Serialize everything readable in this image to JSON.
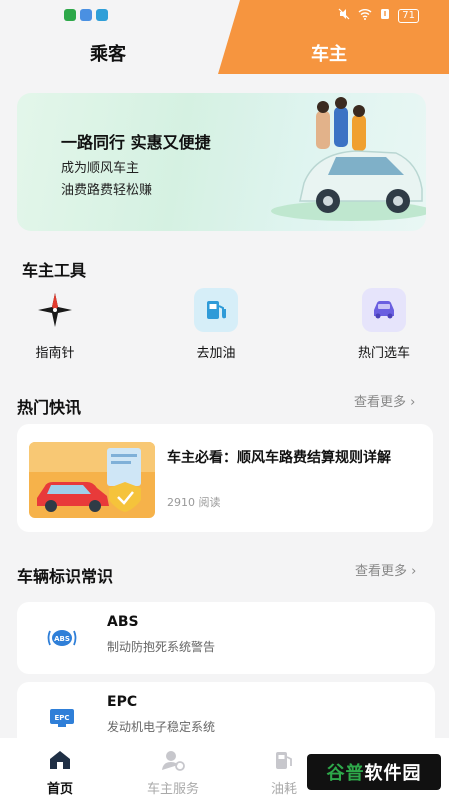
{
  "status_bar": {
    "battery": "71"
  },
  "tabs": [
    {
      "label": "乘客",
      "active": false
    },
    {
      "label": "车主",
      "active": true
    }
  ],
  "banner": {
    "title": "一路同行 实惠又便捷",
    "subtitle_line1": "成为顺风车主",
    "subtitle_line2": "油费路费轻松赚"
  },
  "tools_section": {
    "title": "车主工具",
    "items": [
      {
        "label": "指南针",
        "icon": "compass-icon"
      },
      {
        "label": "去加油",
        "icon": "fuel-pump-icon"
      },
      {
        "label": "热门选车",
        "icon": "car-icon"
      }
    ]
  },
  "news_section": {
    "title": "热门快讯",
    "more": "查看更多",
    "item": {
      "title": "车主必看：顺风车路费结算规则详解",
      "reads": "2910 阅读"
    }
  },
  "indicators_section": {
    "title": "车辆标识常识",
    "more": "查看更多",
    "items": [
      {
        "title": "ABS",
        "desc": "制动防抱死系统警告",
        "icon": "abs-warning-icon"
      },
      {
        "title": "EPC",
        "desc": "发动机电子稳定系统",
        "icon": "epc-warning-icon"
      }
    ]
  },
  "bottom_nav": [
    {
      "label": "首页",
      "icon": "home-icon",
      "active": true
    },
    {
      "label": "车主服务",
      "icon": "driver-service-icon",
      "active": false
    },
    {
      "label": "油耗",
      "icon": "fuel-icon",
      "active": false
    }
  ],
  "watermark": {
    "part1": "谷普",
    "part2": "软件园"
  },
  "colors": {
    "accent": "#f6953f",
    "banner_green": "#d5f1e2"
  }
}
